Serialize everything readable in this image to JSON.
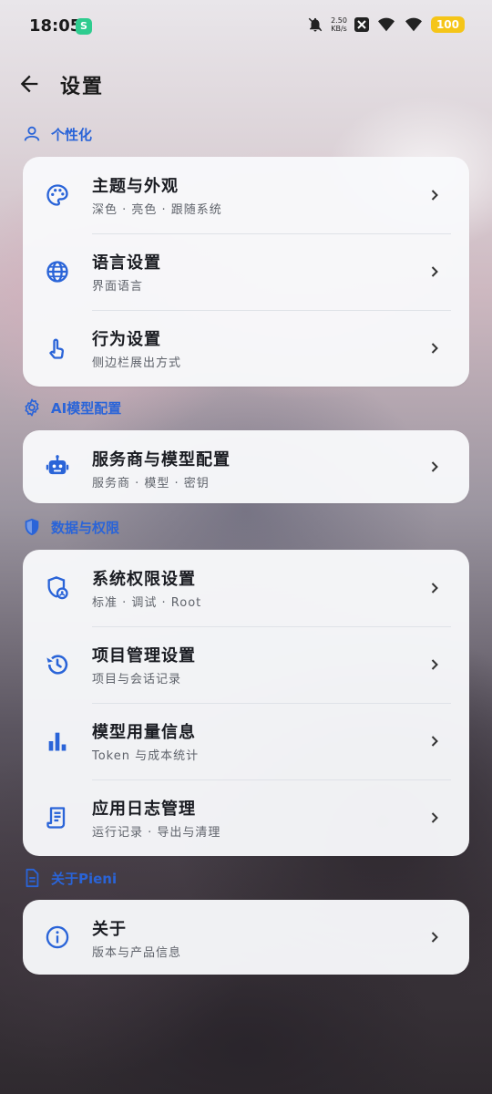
{
  "status_bar": {
    "time": "18:05",
    "app_badge": "S",
    "net_speed_value": "2.50",
    "net_speed_unit": "KB/s",
    "battery": "100"
  },
  "header": {
    "title": "设置"
  },
  "sections": [
    {
      "title": "个性化",
      "icon": "person-icon",
      "items": [
        {
          "title": "主题与外观",
          "subtitle": "深色 · 亮色 · 跟随系统",
          "icon": "palette-icon"
        },
        {
          "title": "语言设置",
          "subtitle": "界面语言",
          "icon": "globe-icon"
        },
        {
          "title": "行为设置",
          "subtitle": "侧边栏展出方式",
          "icon": "touch-icon"
        }
      ]
    },
    {
      "title": "AI模型配置",
      "icon": "gear-icon",
      "items": [
        {
          "title": "服务商与模型配置",
          "subtitle": "服务商 · 模型 · 密钥",
          "icon": "robot-icon"
        }
      ]
    },
    {
      "title": "数据与权限",
      "icon": "shield-icon",
      "items": [
        {
          "title": "系统权限设置",
          "subtitle": "标准 · 调试 · Root",
          "icon": "admin-shield-icon"
        },
        {
          "title": "项目管理设置",
          "subtitle": "项目与会话记录",
          "icon": "history-icon"
        },
        {
          "title": "模型用量信息",
          "subtitle": "Token 与成本统计",
          "icon": "bar-chart-icon"
        },
        {
          "title": "应用日志管理",
          "subtitle": "运行记录 · 导出与清理",
          "icon": "receipt-icon"
        }
      ]
    },
    {
      "title": "关于Pieni",
      "icon": "document-icon",
      "items": [
        {
          "title": "关于",
          "subtitle": "版本与产品信息",
          "icon": "info-icon"
        }
      ]
    }
  ],
  "colors": {
    "accent": "#2a64d8",
    "battery": "#f5c518"
  }
}
